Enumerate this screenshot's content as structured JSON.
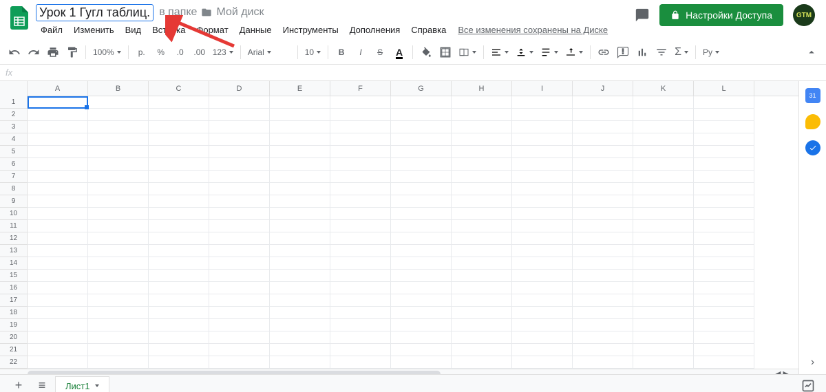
{
  "header": {
    "doc_title": "Урок 1 Гугл таблиц.",
    "in_folder": "в папке",
    "folder_name": "Мой диск",
    "share_label": "Настройки Доступа",
    "avatar_text": "GTM"
  },
  "menu": {
    "file": "Файл",
    "edit": "Изменить",
    "view": "Вид",
    "insert": "Вставка",
    "format": "Формат",
    "data": "Данные",
    "tools": "Инструменты",
    "addons": "Дополнения",
    "help": "Справка",
    "save_status": "Все изменения сохранены на Диске"
  },
  "toolbar": {
    "zoom": "100%",
    "currency": "р.",
    "percent": "%",
    "dec_dec": ".0",
    "inc_dec": ".00",
    "format123": "123",
    "font": "Arial",
    "fontsize": "10",
    "lang": "Ру"
  },
  "fx": {
    "label": "fx"
  },
  "columns": [
    "A",
    "B",
    "C",
    "D",
    "E",
    "F",
    "G",
    "H",
    "I",
    "J",
    "K",
    "L"
  ],
  "rows": [
    "1",
    "2",
    "3",
    "4",
    "5",
    "6",
    "7",
    "8",
    "9",
    "10",
    "11",
    "12",
    "13",
    "14",
    "15",
    "16",
    "17",
    "18",
    "19",
    "20",
    "21",
    "22"
  ],
  "tabs": {
    "sheet1": "Лист1"
  }
}
